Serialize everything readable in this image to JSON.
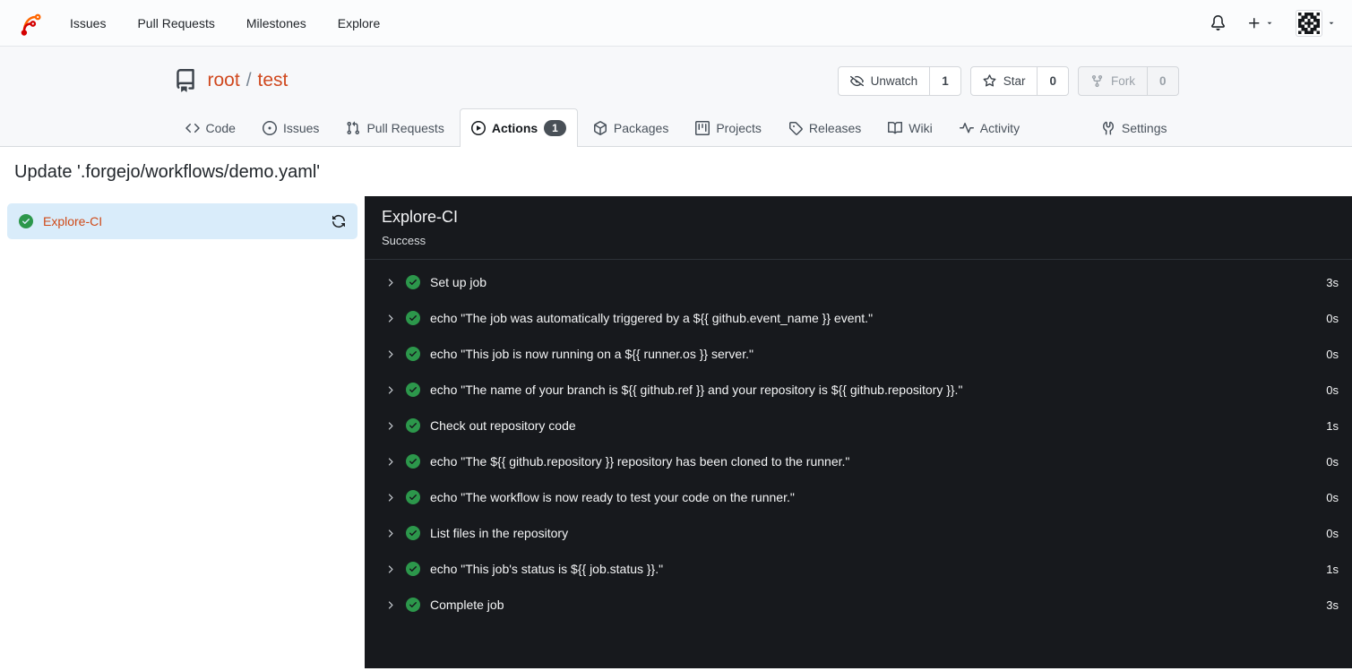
{
  "navbar": {
    "items": [
      "Issues",
      "Pull Requests",
      "Milestones",
      "Explore"
    ]
  },
  "repo": {
    "owner": "root",
    "separator": "/",
    "name": "test",
    "actions": [
      {
        "label": "Unwatch",
        "count": "1"
      },
      {
        "label": "Star",
        "count": "0"
      },
      {
        "label": "Fork",
        "count": "0",
        "disabled": true
      }
    ]
  },
  "tabs": [
    {
      "label": "Code"
    },
    {
      "label": "Issues"
    },
    {
      "label": "Pull Requests"
    },
    {
      "label": "Actions",
      "badge": "1",
      "active": true
    },
    {
      "label": "Packages"
    },
    {
      "label": "Projects"
    },
    {
      "label": "Releases"
    },
    {
      "label": "Wiki"
    },
    {
      "label": "Activity"
    },
    {
      "label": "Settings"
    }
  ],
  "page": {
    "title": "Update '.forgejo/workflows/demo.yaml'"
  },
  "sidebar": {
    "jobs": [
      {
        "name": "Explore-CI",
        "status": "success"
      }
    ]
  },
  "run_panel": {
    "job_name": "Explore-CI",
    "status": "Success",
    "steps": [
      {
        "name": "Set up job",
        "duration": "3s"
      },
      {
        "name": "echo \"The job was automatically triggered by a ${{ github.event_name }} event.\"",
        "duration": "0s"
      },
      {
        "name": "echo \"This job is now running on a ${{ runner.os }} server.\"",
        "duration": "0s"
      },
      {
        "name": "echo \"The name of your branch is ${{ github.ref }} and your repository is ${{ github.repository }}.\"",
        "duration": "0s"
      },
      {
        "name": "Check out repository code",
        "duration": "1s"
      },
      {
        "name": "echo \"The ${{ github.repository }} repository has been cloned to the runner.\"",
        "duration": "0s"
      },
      {
        "name": "echo \"The workflow is now ready to test your code on the runner.\"",
        "duration": "0s"
      },
      {
        "name": "List files in the repository",
        "duration": "0s"
      },
      {
        "name": "echo \"This job's status is ${{ job.status }}.\"",
        "duration": "1s"
      },
      {
        "name": "Complete job",
        "duration": "3s"
      }
    ]
  },
  "colors": {
    "brand_orange": "#ff6600",
    "brand_red": "#d40000",
    "link_accent": "#d0491f",
    "success_green": "#2c974b",
    "selected_job_bg": "#d9ecfa",
    "panel_bg": "#17191d",
    "badge_bg": "#495057"
  }
}
